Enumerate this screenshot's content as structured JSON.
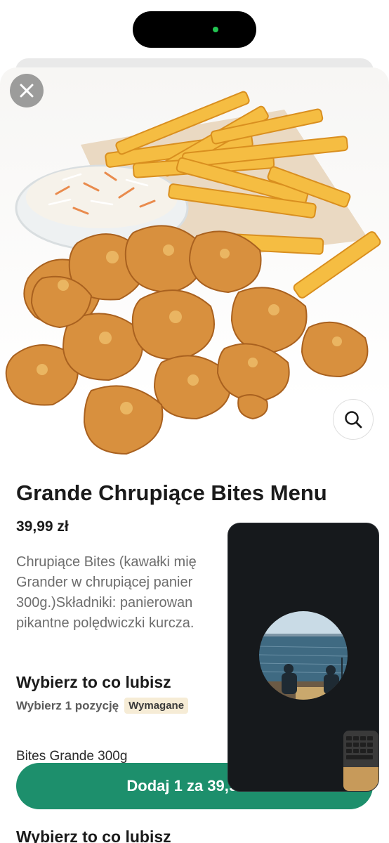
{
  "system": {
    "status_dot_color": "#23c552"
  },
  "modal": {
    "close_icon": "close-icon",
    "zoom_icon": "search-icon"
  },
  "product": {
    "title": "Grande Chrupiące Bites Menu",
    "price": "39,99 zł",
    "description_lines": [
      "Chrupiące Bites (kawałki mię",
      "Grander w chrupiącej panier",
      "300g.)Składniki: panierowan",
      "pikantne polędwiczki kurcza."
    ]
  },
  "choice_section": {
    "title": "Wybierz to co lubisz",
    "subtitle": "Wybierz 1 pozycję",
    "required_badge": "Wymagane",
    "first_option": "Bites Grande 300g"
  },
  "next_section": {
    "title": "Wybierz to co lubisz"
  },
  "cta": {
    "label": "Dodaj 1 za 39,99 zł",
    "color": "#1d8f6c"
  }
}
